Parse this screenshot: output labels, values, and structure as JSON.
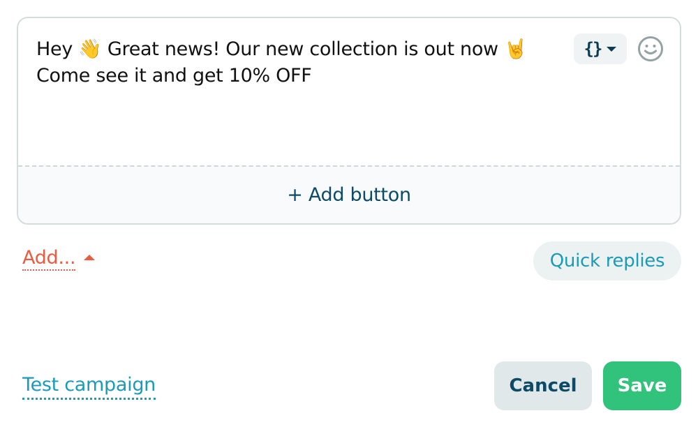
{
  "composer": {
    "message_line1": "Hey 👋 Great news! Our new collection is out now 🤘",
    "message_line2": "Come see it and get 10% OFF",
    "variables_button_label": "{}",
    "variables_icon": "curly-braces-icon",
    "emoji_icon": "smiley-face-icon",
    "add_button_label": "+ Add button"
  },
  "toolbar": {
    "add_menu_label": "Add...",
    "add_menu_icon": "caret-up-icon",
    "quick_replies_label": "Quick replies"
  },
  "footer": {
    "test_campaign_label": "Test campaign",
    "cancel_label": "Cancel",
    "save_label": "Save"
  },
  "colors": {
    "accent_orange": "#ea5b3f",
    "accent_teal": "#1a9bb8",
    "save_green": "#31c27c",
    "navy_text": "#0d4a66"
  }
}
